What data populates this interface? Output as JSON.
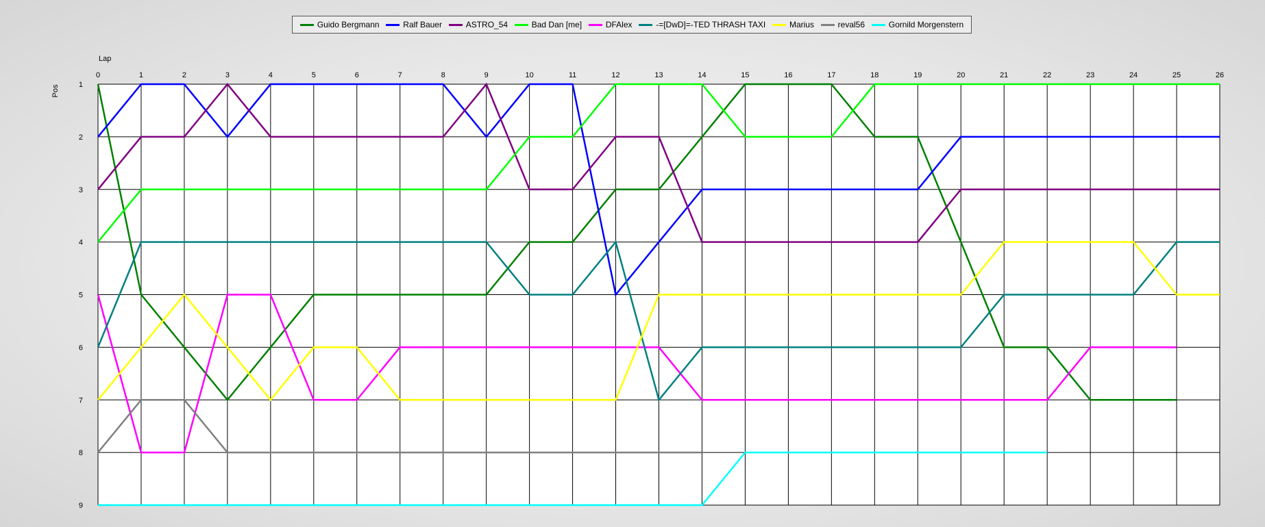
{
  "chart_data": {
    "type": "line",
    "xlabel": "Lap",
    "ylabel": "Pos",
    "x": [
      0,
      1,
      2,
      3,
      4,
      5,
      6,
      7,
      8,
      9,
      10,
      11,
      12,
      13,
      14,
      15,
      16,
      17,
      18,
      19,
      20,
      21,
      22,
      23,
      24,
      25,
      26
    ],
    "xlim": [
      0,
      26
    ],
    "ylim": [
      1,
      9
    ],
    "y_inverted": true,
    "y_ticks": [
      1,
      2,
      3,
      4,
      5,
      6,
      7,
      8,
      9
    ],
    "grid": true,
    "legend_position": "top",
    "series": [
      {
        "name": "Guido Bergmann",
        "color": "#008000",
        "values": [
          1,
          5,
          6,
          7,
          6,
          5,
          5,
          5,
          5,
          5,
          4,
          4,
          3,
          3,
          2,
          1,
          1,
          1,
          2,
          2,
          4,
          6,
          6,
          7,
          7,
          7,
          null
        ]
      },
      {
        "name": "Ralf Bauer",
        "color": "#0000ff",
        "values": [
          2,
          1,
          1,
          2,
          1,
          1,
          1,
          1,
          1,
          2,
          1,
          1,
          5,
          4,
          3,
          3,
          3,
          3,
          3,
          3,
          2,
          2,
          2,
          2,
          2,
          2,
          2
        ]
      },
      {
        "name": "ASTRO_54",
        "color": "#800080",
        "values": [
          3,
          2,
          2,
          1,
          2,
          2,
          2,
          2,
          2,
          1,
          3,
          3,
          2,
          2,
          4,
          4,
          4,
          4,
          4,
          4,
          3,
          3,
          3,
          3,
          3,
          3,
          3
        ]
      },
      {
        "name": "Bad Dan [me]",
        "color": "#00ff00",
        "values": [
          4,
          3,
          3,
          3,
          3,
          3,
          3,
          3,
          3,
          3,
          2,
          2,
          1,
          1,
          1,
          2,
          2,
          2,
          1,
          1,
          1,
          1,
          1,
          1,
          1,
          1,
          1
        ]
      },
      {
        "name": "DFAlex",
        "color": "#ff00ff",
        "values": [
          5,
          8,
          8,
          5,
          5,
          7,
          7,
          6,
          6,
          6,
          6,
          6,
          6,
          6,
          7,
          7,
          7,
          7,
          7,
          7,
          7,
          7,
          7,
          6,
          6,
          6,
          null
        ]
      },
      {
        "name": "-=[DwD]=-TED THRASH TAXI",
        "color": "#008080",
        "values": [
          6,
          4,
          4,
          4,
          4,
          4,
          4,
          4,
          4,
          4,
          5,
          5,
          4,
          7,
          6,
          6,
          6,
          6,
          6,
          6,
          6,
          5,
          5,
          5,
          5,
          4,
          4
        ]
      },
      {
        "name": "Marius",
        "color": "#ffff00",
        "values": [
          7,
          6,
          5,
          6,
          7,
          6,
          6,
          7,
          7,
          7,
          7,
          7,
          7,
          5,
          5,
          5,
          5,
          5,
          5,
          5,
          5,
          4,
          4,
          4,
          4,
          5,
          5
        ]
      },
      {
        "name": "reval56",
        "color": "#808080",
        "values": [
          8,
          7,
          7,
          8,
          8,
          8,
          8,
          8,
          8,
          8,
          8,
          8,
          8,
          8,
          8,
          null,
          null,
          null,
          null,
          null,
          null,
          null,
          null,
          null,
          null,
          null,
          null
        ]
      },
      {
        "name": "Gornild Morgenstern",
        "color": "#00ffff",
        "values": [
          9,
          9,
          9,
          9,
          9,
          9,
          9,
          9,
          9,
          9,
          9,
          9,
          9,
          9,
          9,
          8,
          8,
          8,
          8,
          8,
          8,
          8,
          8,
          null,
          null,
          null,
          null
        ]
      }
    ]
  }
}
